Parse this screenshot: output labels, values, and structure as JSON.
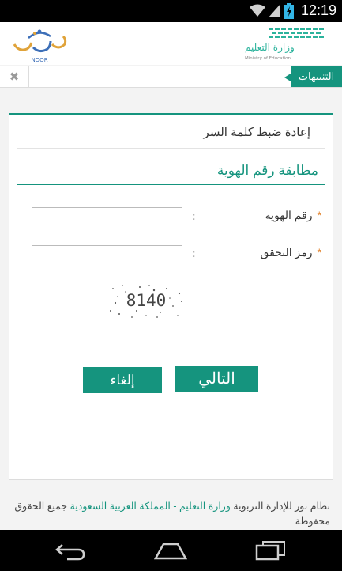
{
  "status_bar": {
    "time": "12:19",
    "icons": [
      "wifi-icon",
      "cell-signal-icon",
      "battery-charging-icon"
    ]
  },
  "header": {
    "left_logo": {
      "caption": "NOOR"
    },
    "right_logo": {
      "title": "وزارة التعليم",
      "subtitle": "Ministry of Education"
    }
  },
  "alerts_bar": {
    "tab_label": "التنبيهات",
    "close_glyph": "✖"
  },
  "form": {
    "page_title": "إعادة ضبط كلمة السر",
    "section_title": "مطابقة رقم الهوية",
    "fields": [
      {
        "label": "رقم الهوية",
        "required_mark": "*",
        "colon": ":",
        "value": "",
        "placeholder": ""
      },
      {
        "label": "رمز التحقق",
        "required_mark": "*",
        "colon": ":",
        "value": "",
        "placeholder": ""
      }
    ],
    "captcha_text": "8140",
    "next_button": "التالي",
    "cancel_button": "إلغاء"
  },
  "footer": {
    "system_name": "نظام نور للإدارة التربوية",
    "ministry_link": "وزارة التعليم - المملكة العربية السعودية",
    "rights": "جميع الحقوق محفوظة"
  },
  "nav_bar": {
    "buttons": [
      "back-icon",
      "home-icon",
      "recent-apps-icon"
    ]
  },
  "colors": {
    "accent": "#15947e",
    "required_star": "#e07b1f"
  }
}
